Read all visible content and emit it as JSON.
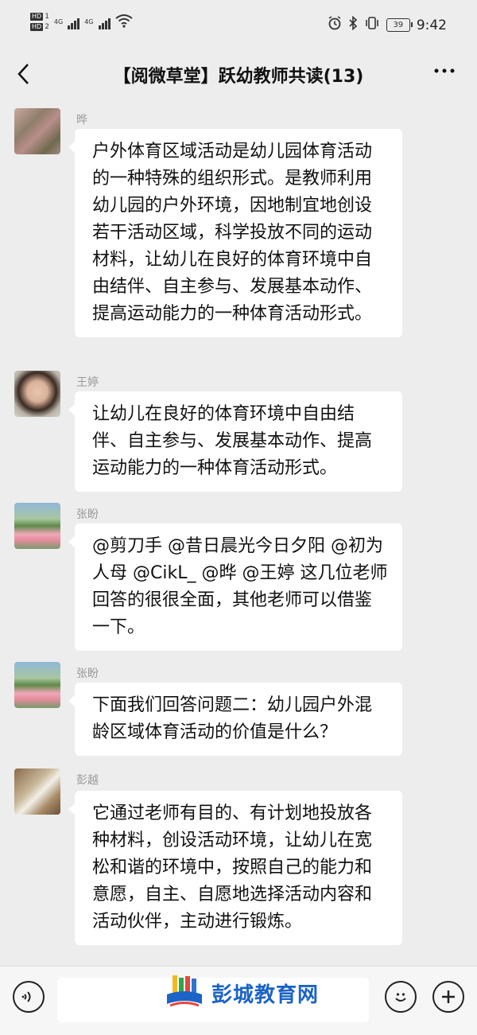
{
  "status_bar": {
    "hd1": "HD",
    "hd1_sim": "1",
    "hd2": "HD",
    "hd2_sim": "2",
    "net1": "4G",
    "net2": "4G",
    "icons": [
      "alarm-icon",
      "bluetooth-icon",
      "vibrate-icon",
      "battery-icon",
      "wifi-icon"
    ],
    "battery": "39",
    "time": "9:42"
  },
  "header": {
    "back_icon": "‹",
    "title": "【阅微草堂】跃幼教师共读(13)",
    "more_icon": "···"
  },
  "messages": [
    {
      "sender": "晔",
      "text": "户外体育区域活动是幼儿园体育活动的一种特殊的组织形式。是教师利用幼儿园的户外环境，因地制宜地创设若干活动区域，科学投放不同的运动材料，让幼儿在良好的体育环境中自由结伴、自主参与、发展基本动作、提高运动能力的一种体育活动形式。"
    },
    {
      "sender": "王婷",
      "text": "让幼儿在良好的体育环境中自由结伴、自主参与、发展基本动作、提高运动能力的一种体育活动形式。"
    },
    {
      "sender": "张盼",
      "text": "@剪刀手  @昔日晨光今日夕阳 @初为人母 @CikL_ @晔 @王婷  这几位老师回答的很很全面，其他老师可以借鉴一下。"
    },
    {
      "sender": "张盼",
      "text": "下面我们回答问题二：幼儿园户外混龄区域体育活动的价值是什么？"
    },
    {
      "sender": "彭越",
      "text": "它通过老师有目的、有计划地投放各种材料，创设活动环境，让幼儿在宽松和谐的环境中，按照自己的能力和意愿，自主、自愿地选择活动内容和活动伙伴，主动进行锻炼。"
    }
  ],
  "input_bar": {
    "voice_icon": "voice-icon",
    "emoji_icon": "emoji-icon",
    "plus_icon": "plus-icon",
    "watermark_text": "彭城教育网"
  },
  "colors": {
    "background": "#ededed",
    "bubble": "#ffffff",
    "sender_name": "#999999",
    "watermark_blue": "#1b63c6"
  }
}
